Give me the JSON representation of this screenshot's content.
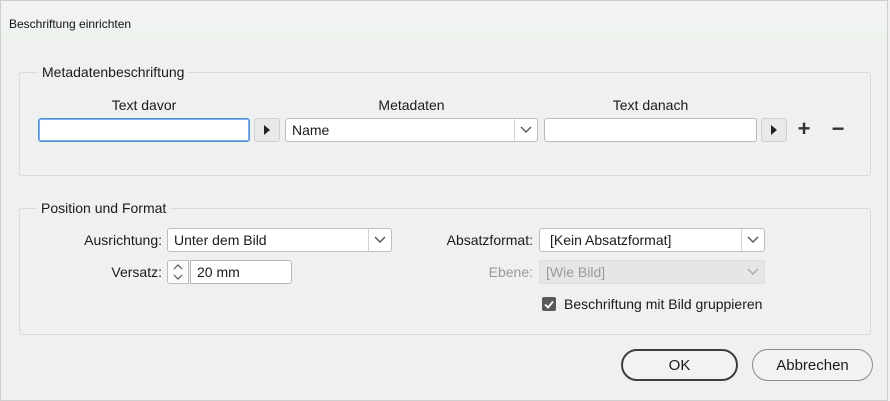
{
  "window": {
    "title": "Beschriftung einrichten"
  },
  "metadata_group": {
    "legend": "Metadatenbeschriftung",
    "text_before_label": "Text davor",
    "metadata_label": "Metadaten",
    "text_after_label": "Text danach",
    "text_before_value": "",
    "metadata_value": "Name",
    "text_after_value": "",
    "add_symbol": "+",
    "remove_symbol": "−"
  },
  "position_group": {
    "legend": "Position und Format",
    "alignment_label": "Ausrichtung:",
    "alignment_value": "Unter dem Bild",
    "offset_label": "Versatz:",
    "offset_value": "20 mm",
    "paragraph_style_label": "Absatzformat:",
    "paragraph_style_value": "[Kein Absatzformat]",
    "layer_label": "Ebene:",
    "layer_value": "[Wie Bild]",
    "group_checkbox_label": "Beschriftung mit Bild gruppieren",
    "group_checkbox_checked": true
  },
  "buttons": {
    "ok": "OK",
    "cancel": "Abbrechen"
  },
  "colors": {
    "focus_border": "#4a90d9",
    "checkbox_fill": "#5a5a5a"
  }
}
